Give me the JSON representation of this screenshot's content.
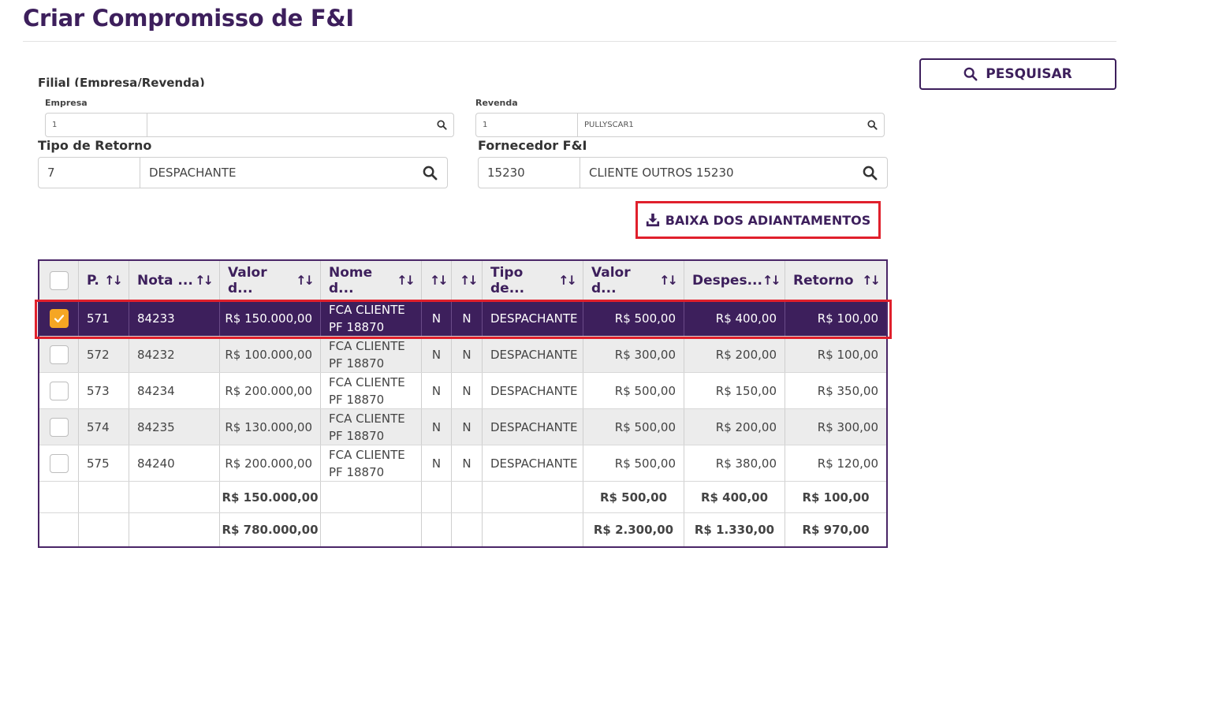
{
  "page_title": "Criar Compromisso de F&I",
  "search_button": {
    "label": "PESQUISAR"
  },
  "filial": {
    "label": "Filial (Empresa/Revenda)",
    "empresa": {
      "label": "Empresa",
      "code": "1",
      "desc": ""
    },
    "revenda": {
      "label": "Revenda",
      "code": "1",
      "desc": "PULLYSCAR1"
    }
  },
  "tipo_retorno": {
    "label": "Tipo de Retorno",
    "code": "7",
    "desc": "DESPACHANTE"
  },
  "fornecedor": {
    "label": "Fornecedor F&I",
    "code": "15230",
    "desc": "CLIENTE OUTROS 15230"
  },
  "baixa_button": {
    "label": "BAIXA DOS ADIANTAMENTOS"
  },
  "table": {
    "headers": [
      "P.",
      "Nota ...",
      "Valor d...",
      "Nome d...",
      "",
      "",
      "Tipo de...",
      "Valor d...",
      "Despes...",
      "Retorno"
    ],
    "sort_glyph": "↑↓",
    "rows": [
      {
        "checked": true,
        "p": "571",
        "nota": "84233",
        "valor": "R$ 150.000,00",
        "nome": "FCA CLIENTE PF 18870",
        "f1": "N",
        "f2": "N",
        "tipo": "DESPACHANTE",
        "valor_ret": "R$ 500,00",
        "despesa": "R$ 400,00",
        "retorno": "R$ 100,00"
      },
      {
        "checked": false,
        "p": "572",
        "nota": "84232",
        "valor": "R$ 100.000,00",
        "nome": "FCA CLIENTE PF 18870",
        "f1": "N",
        "f2": "N",
        "tipo": "DESPACHANTE",
        "valor_ret": "R$ 300,00",
        "despesa": "R$ 200,00",
        "retorno": "R$ 100,00"
      },
      {
        "checked": false,
        "p": "573",
        "nota": "84234",
        "valor": "R$ 200.000,00",
        "nome": "FCA CLIENTE PF 18870",
        "f1": "N",
        "f2": "N",
        "tipo": "DESPACHANTE",
        "valor_ret": "R$ 500,00",
        "despesa": "R$ 150,00",
        "retorno": "R$ 350,00"
      },
      {
        "checked": false,
        "p": "574",
        "nota": "84235",
        "valor": "R$ 130.000,00",
        "nome": "FCA CLIENTE PF 18870",
        "f1": "N",
        "f2": "N",
        "tipo": "DESPACHANTE",
        "valor_ret": "R$ 500,00",
        "despesa": "R$ 200,00",
        "retorno": "R$ 300,00"
      },
      {
        "checked": false,
        "p": "575",
        "nota": "84240",
        "valor": "R$ 200.000,00",
        "nome": "FCA CLIENTE PF 18870",
        "f1": "N",
        "f2": "N",
        "tipo": "DESPACHANTE",
        "valor_ret": "R$ 500,00",
        "despesa": "R$ 380,00",
        "retorno": "R$ 120,00"
      }
    ],
    "totals": [
      {
        "valor": "R$ 150.000,00",
        "valor_ret": "R$ 500,00",
        "despesa": "R$ 400,00",
        "retorno": "R$ 100,00"
      },
      {
        "valor": "R$ 780.000,00",
        "valor_ret": "R$ 2.300,00",
        "despesa": "R$ 1.330,00",
        "retorno": "R$ 970,00"
      }
    ]
  },
  "colors": {
    "primary": "#3d1f5c",
    "highlight": "#e0202c",
    "checkbox_on": "#f5a623"
  }
}
